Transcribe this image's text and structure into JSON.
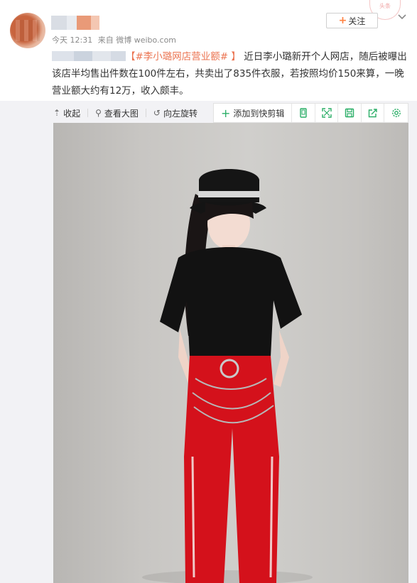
{
  "post": {
    "meta": {
      "time": "今天 12:31",
      "source": "来自 微博 weibo.com"
    },
    "follow_label": "关注",
    "stamp_text": "头条",
    "content": {
      "bracket_open": "【",
      "topic": "#李小璐网店营业额#",
      "bracket_close": " 】",
      "text": "近日李小璐新开个人网店，随后被曝出该店半均售出件数在100件左右，共卖出了835件衣服，若按照均价150来算，一晚营业额大约有12万，收入颇丰。"
    }
  },
  "toolbar": {
    "collapse": "收起",
    "view_large": "查看大图",
    "rotate_left": "向左旋转",
    "add_to_clip": "添加到快剪辑"
  },
  "icons": {
    "collapse": "arrow-up-icon",
    "view_large": "magnifier-icon",
    "rotate_left": "rotate-left-icon",
    "quick": [
      "phone-icon",
      "fullscreen-icon",
      "save-icon",
      "share-icon",
      "settings-icon"
    ]
  },
  "colors": {
    "accent_orange": "#eb7350",
    "quick_green": "#2aae67",
    "follow_plus": "#ff8140"
  }
}
